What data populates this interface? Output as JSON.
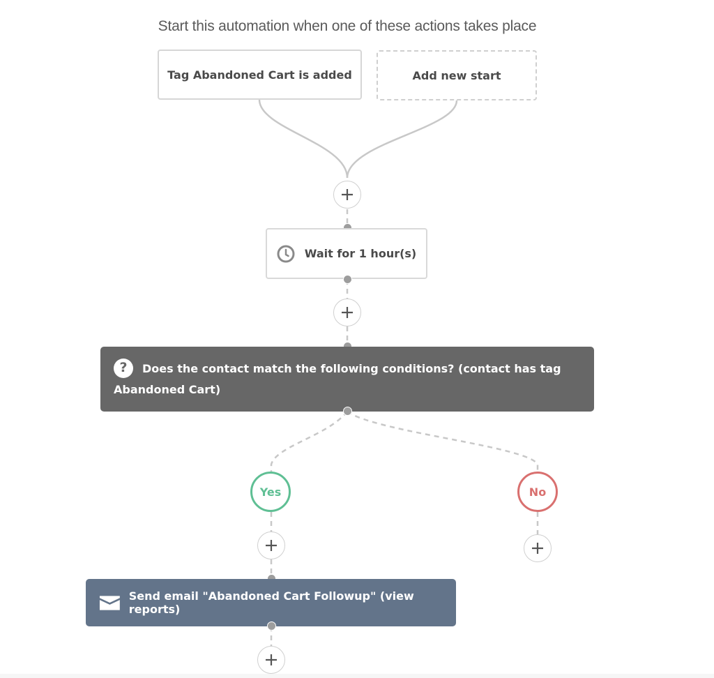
{
  "heading": "Start this automation when one of these actions takes place",
  "triggers": [
    {
      "label": "Tag Abandoned Cart is added"
    },
    {
      "label": "Add new start"
    }
  ],
  "steps": {
    "wait": {
      "label": "Wait for 1 hour(s)",
      "icon": "clock-icon"
    },
    "condition": {
      "label": "Does the contact match the following conditions? (contact has tag Abandoned Cart)",
      "icon": "question-icon",
      "icon_glyph": "?"
    },
    "email": {
      "label": "Send email \"Abandoned Cart Followup\" (view reports)",
      "icon": "envelope-icon"
    }
  },
  "branches": {
    "yes": {
      "label": "Yes",
      "color": "#5fbf94"
    },
    "no": {
      "label": "No",
      "color": "#d9706f"
    }
  },
  "add_step_icon": "plus-icon",
  "colors": {
    "condition_bg": "#676767",
    "email_bg": "#63748a",
    "connector": "#c8c8c8",
    "node_dot": "#9d9d9d"
  }
}
